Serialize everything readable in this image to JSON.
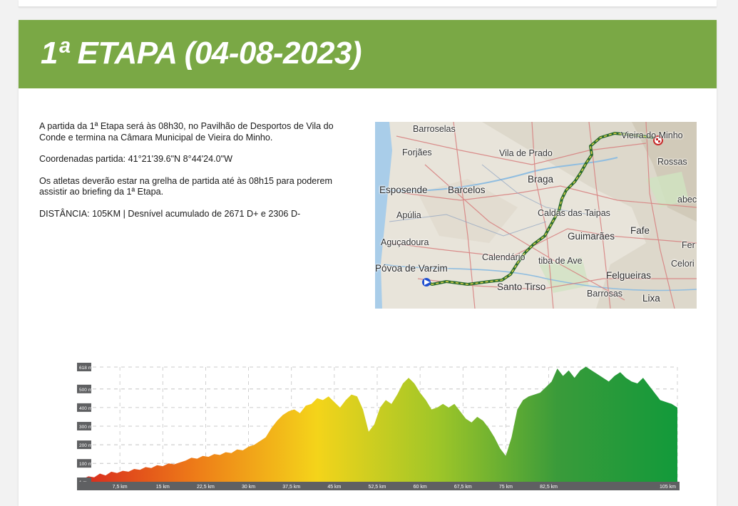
{
  "stage": {
    "title": "1ª ETAPA (04-08-2023)",
    "intro": "A partida da 1ª Etapa será às 08h30, no Pavilhão de Desportos de Vila do Conde e termina na Câmara Municipal de Vieira do Minho.",
    "coordinates": "Coordenadas partida: 41°21'39.6\"N 8°44'24.0\"W",
    "grid_note": "Os atletas deverão estar na grelha de partida até às 08h15 para poderem assistir ao briefing da 1ª Etapa.",
    "distance": "DISTÂNCIA: 105KM |  Desnível acumulado de 2671 D+ e 2306 D-"
  },
  "map": {
    "labels": [
      {
        "id": "barroselas",
        "text": "Barroselas"
      },
      {
        "id": "vieira",
        "text": "Vieira do Minho"
      },
      {
        "id": "forjaes",
        "text": "Forjães"
      },
      {
        "id": "vila-de-prado",
        "text": "Vila de Prado"
      },
      {
        "id": "rossas",
        "text": "Rossas"
      },
      {
        "id": "braga",
        "text": "Braga"
      },
      {
        "id": "esposende",
        "text": "Esposende"
      },
      {
        "id": "barcelos",
        "text": "Barcelos"
      },
      {
        "id": "abec",
        "text": "abec"
      },
      {
        "id": "apulia",
        "text": "Apúlia"
      },
      {
        "id": "caldas",
        "text": "Caldas das Taipas"
      },
      {
        "id": "fafe",
        "text": "Fafe"
      },
      {
        "id": "guimaraes",
        "text": "Guimarães"
      },
      {
        "id": "agucadoura",
        "text": "Aguçadoura"
      },
      {
        "id": "fer",
        "text": "Fer"
      },
      {
        "id": "calendario",
        "text": "Calendário"
      },
      {
        "id": "riba-de-ave",
        "text": "tiba de Ave"
      },
      {
        "id": "celori",
        "text": "Celori"
      },
      {
        "id": "povoa",
        "text": "Póvoa de Varzim"
      },
      {
        "id": "felgueiras",
        "text": "Felgueiras"
      },
      {
        "id": "santo-tirso",
        "text": "Santo Tirso"
      },
      {
        "id": "barrosas",
        "text": "Barrosas"
      },
      {
        "id": "lixa",
        "text": "Lixa"
      }
    ],
    "colors": {
      "sea": "#a9cde9",
      "land": "#e8e4da",
      "route": "#2a6b2e",
      "route_highlight": "#e7d84a",
      "start": "#1f4fd1",
      "finish": "#c62828"
    }
  },
  "chart_data": {
    "type": "area",
    "title": "",
    "xlabel": "",
    "ylabel": "",
    "y_axis_labels": [
      "1 m",
      "100 m",
      "200 m",
      "300 m",
      "400 m",
      "500 m",
      "618 m"
    ],
    "x_axis_labels": [
      "7,5 km",
      "15 km",
      "22,5 km",
      "30 km",
      "37,5 km",
      "45 km",
      "52,5 km",
      "60 km",
      "67,5 km",
      "75 km",
      "82,5 km",
      "105 km"
    ],
    "ylim": [
      1,
      618
    ],
    "xlim": [
      0,
      105
    ],
    "grid": true,
    "gradient_colors": [
      "#d7261e",
      "#ee7d18",
      "#f4d41a",
      "#9fc628",
      "#3a9b3a",
      "#129a3a"
    ],
    "series": [
      {
        "x": [
          0,
          1,
          2,
          3,
          4,
          5,
          6,
          7,
          8,
          9,
          10,
          11,
          12,
          13,
          14,
          15,
          16,
          17,
          18,
          19,
          20,
          21,
          22,
          23,
          24,
          25,
          26,
          27,
          28,
          29,
          30,
          31,
          32,
          33,
          34,
          35,
          36,
          37,
          38,
          39,
          40,
          41,
          42,
          43,
          44,
          45,
          46,
          47,
          48,
          49,
          50,
          51,
          52,
          53,
          54,
          55,
          56,
          57,
          58,
          59,
          60,
          61,
          62,
          63,
          64,
          65,
          66,
          67,
          68,
          69,
          70,
          71,
          72,
          73,
          74,
          75,
          76,
          77,
          78,
          79,
          80,
          81,
          82,
          83,
          84,
          85,
          86,
          87,
          88,
          89,
          90,
          91,
          92,
          93,
          94,
          95,
          96,
          97,
          98,
          99,
          100,
          101,
          102,
          103,
          104,
          105
        ],
        "y": [
          20,
          15,
          30,
          25,
          45,
          35,
          55,
          48,
          60,
          55,
          70,
          65,
          80,
          75,
          90,
          85,
          100,
          95,
          105,
          115,
          130,
          125,
          140,
          135,
          150,
          145,
          160,
          155,
          175,
          170,
          190,
          200,
          220,
          240,
          290,
          330,
          360,
          380,
          390,
          370,
          410,
          420,
          450,
          440,
          460,
          430,
          400,
          440,
          470,
          460,
          390,
          270,
          310,
          400,
          440,
          420,
          470,
          530,
          560,
          530,
          480,
          440,
          390,
          400,
          420,
          400,
          420,
          380,
          340,
          320,
          350,
          330,
          290,
          240,
          180,
          140,
          240,
          390,
          440,
          460,
          470,
          480,
          510,
          540,
          610,
          570,
          600,
          560,
          600,
          620,
          600,
          580,
          560,
          540,
          570,
          590,
          560,
          540,
          530,
          560,
          520,
          480,
          440,
          430,
          420,
          400
        ]
      }
    ]
  }
}
